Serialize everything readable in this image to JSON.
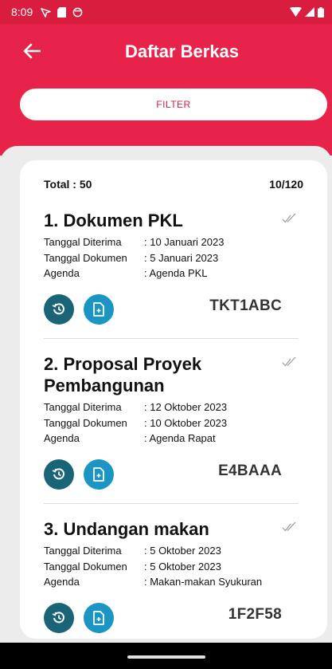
{
  "status_bar": {
    "time": "8:09"
  },
  "app_bar": {
    "title": "Daftar Berkas"
  },
  "filter": {
    "label": "FILTER"
  },
  "summary": {
    "total": "Total : 50",
    "page": "10/120"
  },
  "documents": [
    {
      "title": "1. Dokumen PKL",
      "rows": [
        {
          "label": "Tanggal Diterima",
          "value": ": 10 Januari 2023"
        },
        {
          "label": "Tanggal Dokumen",
          "value": ": 5 Januari 2023"
        },
        {
          "label": "Agenda",
          "value": ": Agenda PKL"
        }
      ],
      "code": "TKT1ABC"
    },
    {
      "title": "2. Proposal Proyek Pembangunan",
      "rows": [
        {
          "label": "Tanggal Diterima",
          "value": ": 12 Oktober 2023"
        },
        {
          "label": "Tanggal Dokumen",
          "value": ": 10 Oktober 2023"
        },
        {
          "label": "Agenda",
          "value": ": Agenda Rapat"
        }
      ],
      "code": "E4BAAA"
    },
    {
      "title": "3. Undangan makan",
      "rows": [
        {
          "label": "Tanggal Diterima",
          "value": ": 5 Oktober 2023"
        },
        {
          "label": "Tanggal Dokumen",
          "value": ": 5 Oktober 2023"
        },
        {
          "label": "Agenda",
          "value": ": Makan-makan Syukuran"
        }
      ],
      "code": "1F2F58"
    }
  ],
  "icons": {
    "back": "arrow-left-icon",
    "history": "history-icon",
    "file": "file-icon",
    "read": "double-check-icon"
  },
  "colors": {
    "primary": "#e8234a",
    "status_bar": "#d81d3f",
    "history_button": "#1a6478",
    "file_button": "#1b96c4"
  }
}
